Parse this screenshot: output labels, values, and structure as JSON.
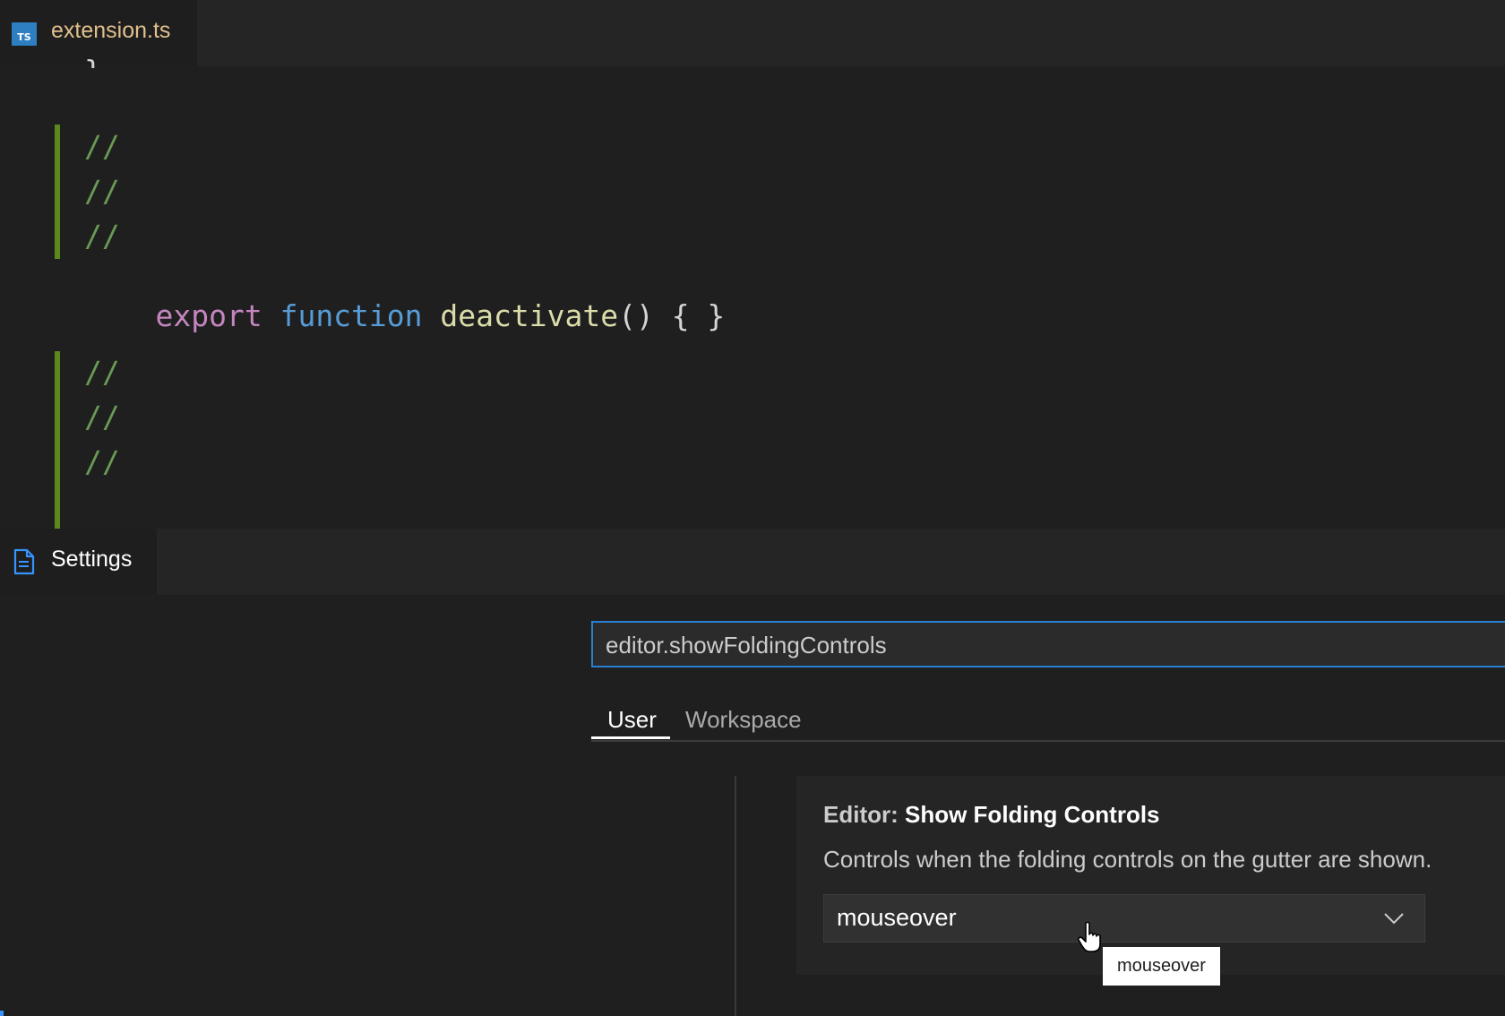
{
  "editor_tab": {
    "label": "extension.ts",
    "icon": "typescript-file-icon"
  },
  "code": {
    "partial_brace": "}",
    "comment": "//",
    "line_export": "export",
    "line_function": "function",
    "line_name": "deactivate",
    "line_rest": "() { }"
  },
  "settings_tab": {
    "label": "Settings",
    "icon": "file-icon"
  },
  "settings": {
    "search_value": "editor.showFoldingControls",
    "tabs": {
      "user": "User",
      "workspace": "Workspace"
    },
    "item": {
      "category": "Editor: ",
      "name": "Show Folding Controls",
      "description": "Controls when the folding controls on the gutter are shown.",
      "selected": "mouseover"
    },
    "tooltip": "mouseover"
  },
  "colors": {
    "accent": "#2a7fd4",
    "gutter_modified": "#5a8a1e",
    "tab_title": "#e2c08d"
  }
}
